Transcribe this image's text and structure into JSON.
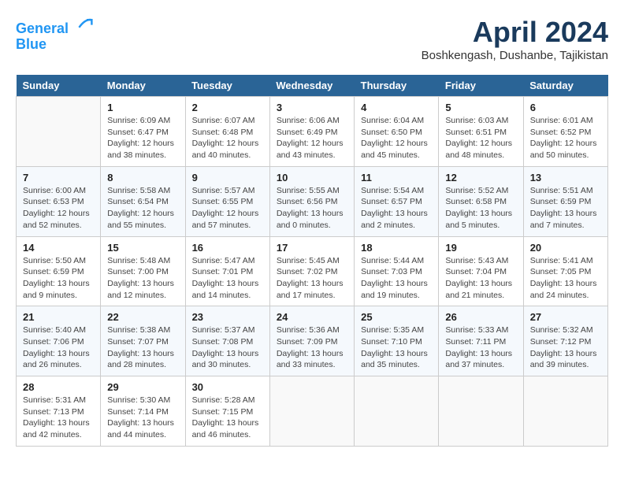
{
  "header": {
    "logo_line1": "General",
    "logo_line2": "Blue",
    "month_title": "April 2024",
    "location": "Boshkengash, Dushanbe, Tajikistan"
  },
  "weekdays": [
    "Sunday",
    "Monday",
    "Tuesday",
    "Wednesday",
    "Thursday",
    "Friday",
    "Saturday"
  ],
  "weeks": [
    [
      {
        "day": "",
        "info": ""
      },
      {
        "day": "1",
        "info": "Sunrise: 6:09 AM\nSunset: 6:47 PM\nDaylight: 12 hours\nand 38 minutes."
      },
      {
        "day": "2",
        "info": "Sunrise: 6:07 AM\nSunset: 6:48 PM\nDaylight: 12 hours\nand 40 minutes."
      },
      {
        "day": "3",
        "info": "Sunrise: 6:06 AM\nSunset: 6:49 PM\nDaylight: 12 hours\nand 43 minutes."
      },
      {
        "day": "4",
        "info": "Sunrise: 6:04 AM\nSunset: 6:50 PM\nDaylight: 12 hours\nand 45 minutes."
      },
      {
        "day": "5",
        "info": "Sunrise: 6:03 AM\nSunset: 6:51 PM\nDaylight: 12 hours\nand 48 minutes."
      },
      {
        "day": "6",
        "info": "Sunrise: 6:01 AM\nSunset: 6:52 PM\nDaylight: 12 hours\nand 50 minutes."
      }
    ],
    [
      {
        "day": "7",
        "info": "Sunrise: 6:00 AM\nSunset: 6:53 PM\nDaylight: 12 hours\nand 52 minutes."
      },
      {
        "day": "8",
        "info": "Sunrise: 5:58 AM\nSunset: 6:54 PM\nDaylight: 12 hours\nand 55 minutes."
      },
      {
        "day": "9",
        "info": "Sunrise: 5:57 AM\nSunset: 6:55 PM\nDaylight: 12 hours\nand 57 minutes."
      },
      {
        "day": "10",
        "info": "Sunrise: 5:55 AM\nSunset: 6:56 PM\nDaylight: 13 hours\nand 0 minutes."
      },
      {
        "day": "11",
        "info": "Sunrise: 5:54 AM\nSunset: 6:57 PM\nDaylight: 13 hours\nand 2 minutes."
      },
      {
        "day": "12",
        "info": "Sunrise: 5:52 AM\nSunset: 6:58 PM\nDaylight: 13 hours\nand 5 minutes."
      },
      {
        "day": "13",
        "info": "Sunrise: 5:51 AM\nSunset: 6:59 PM\nDaylight: 13 hours\nand 7 minutes."
      }
    ],
    [
      {
        "day": "14",
        "info": "Sunrise: 5:50 AM\nSunset: 6:59 PM\nDaylight: 13 hours\nand 9 minutes."
      },
      {
        "day": "15",
        "info": "Sunrise: 5:48 AM\nSunset: 7:00 PM\nDaylight: 13 hours\nand 12 minutes."
      },
      {
        "day": "16",
        "info": "Sunrise: 5:47 AM\nSunset: 7:01 PM\nDaylight: 13 hours\nand 14 minutes."
      },
      {
        "day": "17",
        "info": "Sunrise: 5:45 AM\nSunset: 7:02 PM\nDaylight: 13 hours\nand 17 minutes."
      },
      {
        "day": "18",
        "info": "Sunrise: 5:44 AM\nSunset: 7:03 PM\nDaylight: 13 hours\nand 19 minutes."
      },
      {
        "day": "19",
        "info": "Sunrise: 5:43 AM\nSunset: 7:04 PM\nDaylight: 13 hours\nand 21 minutes."
      },
      {
        "day": "20",
        "info": "Sunrise: 5:41 AM\nSunset: 7:05 PM\nDaylight: 13 hours\nand 24 minutes."
      }
    ],
    [
      {
        "day": "21",
        "info": "Sunrise: 5:40 AM\nSunset: 7:06 PM\nDaylight: 13 hours\nand 26 minutes."
      },
      {
        "day": "22",
        "info": "Sunrise: 5:38 AM\nSunset: 7:07 PM\nDaylight: 13 hours\nand 28 minutes."
      },
      {
        "day": "23",
        "info": "Sunrise: 5:37 AM\nSunset: 7:08 PM\nDaylight: 13 hours\nand 30 minutes."
      },
      {
        "day": "24",
        "info": "Sunrise: 5:36 AM\nSunset: 7:09 PM\nDaylight: 13 hours\nand 33 minutes."
      },
      {
        "day": "25",
        "info": "Sunrise: 5:35 AM\nSunset: 7:10 PM\nDaylight: 13 hours\nand 35 minutes."
      },
      {
        "day": "26",
        "info": "Sunrise: 5:33 AM\nSunset: 7:11 PM\nDaylight: 13 hours\nand 37 minutes."
      },
      {
        "day": "27",
        "info": "Sunrise: 5:32 AM\nSunset: 7:12 PM\nDaylight: 13 hours\nand 39 minutes."
      }
    ],
    [
      {
        "day": "28",
        "info": "Sunrise: 5:31 AM\nSunset: 7:13 PM\nDaylight: 13 hours\nand 42 minutes."
      },
      {
        "day": "29",
        "info": "Sunrise: 5:30 AM\nSunset: 7:14 PM\nDaylight: 13 hours\nand 44 minutes."
      },
      {
        "day": "30",
        "info": "Sunrise: 5:28 AM\nSunset: 7:15 PM\nDaylight: 13 hours\nand 46 minutes."
      },
      {
        "day": "",
        "info": ""
      },
      {
        "day": "",
        "info": ""
      },
      {
        "day": "",
        "info": ""
      },
      {
        "day": "",
        "info": ""
      }
    ]
  ]
}
